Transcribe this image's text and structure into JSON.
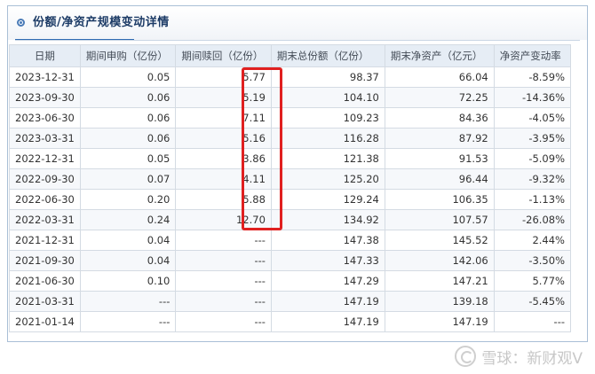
{
  "panel": {
    "title": "份额/净资产规模变动详情"
  },
  "table": {
    "headers": [
      "日期",
      "期间申购（亿份）",
      "期间赎回（亿份）",
      "期末总份额（亿份）",
      "期末净资产（亿元）",
      "净资产变动率"
    ],
    "rows": [
      [
        "2023-12-31",
        "0.05",
        "5.77",
        "98.37",
        "66.04",
        "-8.59%"
      ],
      [
        "2023-09-30",
        "0.06",
        "5.19",
        "104.10",
        "72.25",
        "-14.36%"
      ],
      [
        "2023-06-30",
        "0.06",
        "7.11",
        "109.23",
        "84.36",
        "-4.05%"
      ],
      [
        "2023-03-31",
        "0.06",
        "5.16",
        "116.28",
        "87.92",
        "-3.95%"
      ],
      [
        "2022-12-31",
        "0.05",
        "3.86",
        "121.38",
        "91.53",
        "-5.09%"
      ],
      [
        "2022-09-30",
        "0.07",
        "4.11",
        "125.20",
        "96.44",
        "-9.32%"
      ],
      [
        "2022-06-30",
        "0.20",
        "5.88",
        "129.24",
        "106.35",
        "-1.13%"
      ],
      [
        "2022-03-31",
        "0.24",
        "12.70",
        "134.92",
        "107.57",
        "-26.08%"
      ],
      [
        "2021-12-31",
        "0.04",
        "---",
        "147.38",
        "145.52",
        "2.44%"
      ],
      [
        "2021-09-30",
        "0.04",
        "---",
        "147.33",
        "142.06",
        "-3.50%"
      ],
      [
        "2021-06-30",
        "0.10",
        "---",
        "147.29",
        "147.21",
        "5.77%"
      ],
      [
        "2021-03-31",
        "---",
        "---",
        "147.19",
        "139.18",
        "-5.45%"
      ],
      [
        "2021-01-14",
        "---",
        "---",
        "147.19",
        "147.19",
        "---"
      ]
    ]
  },
  "watermark": {
    "text": "雪球：新财观V",
    "icon": "snowball-logo-icon"
  },
  "colors": {
    "highlight": "#e02020",
    "header_bg": "#e6edf5",
    "accent": "#2f6bb3"
  }
}
